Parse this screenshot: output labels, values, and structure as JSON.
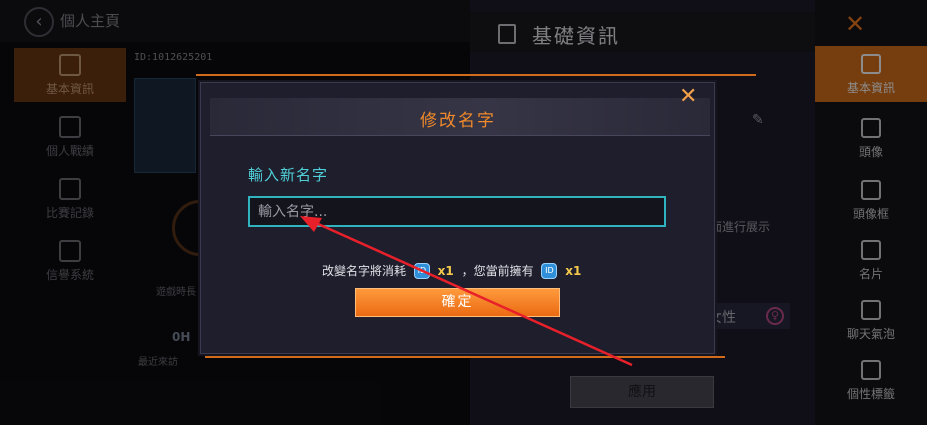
{
  "header": {
    "back_icon": "chevron-left-icon",
    "title": "個人主頁"
  },
  "left_nav": [
    {
      "label": "基本資訊",
      "icon": "id-card-icon",
      "active": true
    },
    {
      "label": "個人戰績",
      "icon": "stats-icon",
      "active": false
    },
    {
      "label": "比賽記錄",
      "icon": "record-icon",
      "active": false
    },
    {
      "label": "信譽系統",
      "icon": "shield-icon",
      "active": false
    }
  ],
  "profile": {
    "id": "ID:1012625201",
    "play_time_label": "遊戲時長",
    "play_time_value": "0H",
    "recent_visit_label": "最近來訪"
  },
  "info_panel": {
    "title": "基礎資訊",
    "display_hint": "面進行展示",
    "gender": "女性",
    "apply_label": "應用"
  },
  "right_nav": [
    {
      "label": "基本資訊",
      "icon": "id-card-icon",
      "active": true
    },
    {
      "label": "頭像",
      "icon": "avatar-icon",
      "active": false
    },
    {
      "label": "頭像框",
      "icon": "frame-icon",
      "active": false
    },
    {
      "label": "名片",
      "icon": "card-icon",
      "active": false
    },
    {
      "label": "聊天氣泡",
      "icon": "chat-bubble-icon",
      "active": false
    },
    {
      "label": "個性標籤",
      "icon": "tag-icon",
      "active": false
    }
  ],
  "modal": {
    "title": "修改名字",
    "new_name_label": "輸入新名字",
    "input_placeholder": "輸入名字...",
    "input_value": "",
    "cost_prefix": "改變名字將消耗",
    "cost_qty": "x1",
    "cost_mid": "，您當前擁有",
    "owned_qty": "x1",
    "coin_icon": "rename-card-icon",
    "coin_text": "ID",
    "confirm_label": "確定",
    "close_icon": "close-icon"
  },
  "colors": {
    "accent": "#f07a1e",
    "cyan": "#2fb3bf",
    "annotation_arrow": "#e8202a"
  }
}
